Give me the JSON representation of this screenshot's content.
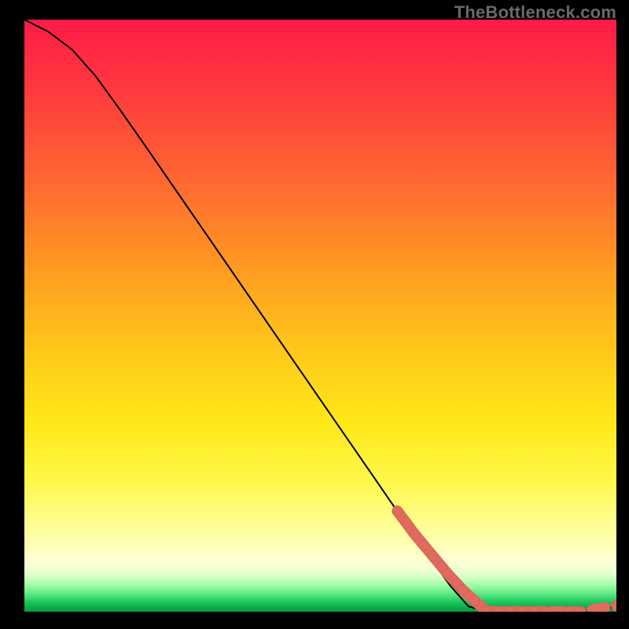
{
  "watermark_text": "TheBottleneck.com",
  "chart_data": {
    "type": "line",
    "title": "",
    "xlabel": "",
    "ylabel": "",
    "xlim": [
      0,
      100
    ],
    "ylim": [
      0,
      100
    ],
    "legend": false,
    "grid": false,
    "background_gradient": {
      "top": "#ff1a47",
      "upper_mid": "#ff9a22",
      "mid": "#ffe818",
      "lower_mid": "#ffff9a",
      "bottom_band": "#1fc85e"
    },
    "series": [
      {
        "name": "bottleneck-curve",
        "color": "#000000",
        "x": [
          0,
          4,
          8,
          12,
          16,
          20,
          24,
          28,
          32,
          36,
          40,
          44,
          48,
          52,
          56,
          60,
          64,
          68,
          72,
          75,
          78,
          81,
          84,
          86,
          88,
          90,
          92,
          94,
          96,
          98,
          100
        ],
        "y": [
          100,
          98,
          95,
          90.5,
          85,
          79.3,
          73.5,
          67.7,
          61.9,
          56.1,
          50.3,
          44.5,
          38.7,
          32.9,
          27.1,
          21.3,
          15.5,
          9.8,
          4.3,
          0.9,
          0,
          0,
          0,
          0,
          0,
          0,
          0,
          0,
          0,
          0.3,
          1
        ]
      },
      {
        "name": "marker-cluster",
        "type": "scatter",
        "color": "#e06b5f",
        "x": [
          63,
          64.5,
          66,
          67.5,
          69,
          70.5,
          71.5,
          73,
          74,
          76,
          78,
          80,
          82,
          84,
          86,
          88,
          92,
          94,
          100
        ],
        "y": [
          17,
          15,
          13,
          11.2,
          9.4,
          7.6,
          6.4,
          4.8,
          3.7,
          1.9,
          0.1,
          0,
          0,
          0,
          0,
          0,
          0,
          0,
          1
        ]
      }
    ]
  }
}
